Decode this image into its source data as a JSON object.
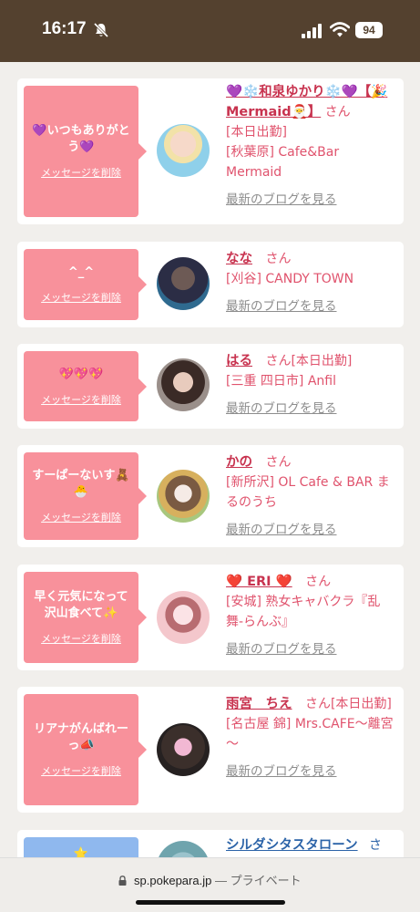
{
  "status_bar": {
    "time": "16:17",
    "battery": "94"
  },
  "labels": {
    "delete": "メッセージを削除",
    "blog": "最新のブログを見る"
  },
  "cards": [
    {
      "message": "💜いつもありがとう💜",
      "name": "💜❄️和泉ゆかり❄️💜【🎉Mermaid🎅】",
      "san": "さん",
      "tag": "[本日出勤]",
      "shop": "[秋葉原] Cafe&Bar Mermaid"
    },
    {
      "message": "^_^",
      "name": "なな",
      "san": "さん",
      "shop": "[刈谷] CANDY TOWN"
    },
    {
      "message": "💖💖💖",
      "name": "はる",
      "san": "さん[本日出勤]",
      "shop": "[三重 四日市] Anfil"
    },
    {
      "message": "すーぱーないす🧸🐣",
      "name": "かの",
      "san": "さん",
      "shop": "[新所沢] OL Cafe & BAR まるのうち"
    },
    {
      "message": "早く元気になって沢山食べて✨",
      "name": "❤️ ERI ❤️",
      "san": "さん",
      "shop": "[安城] 熟女キャバクラ『乱舞-らんぶ』"
    },
    {
      "message": "リアナがんばれーっ📣",
      "name": "雨宮　ちえ",
      "san": "さん[本日出勤]",
      "shop": "[名古屋 錦] Mrs.CAFE～離宮～"
    },
    {
      "message": "⭐",
      "name": "シルダシタスタローン",
      "san": "さ"
    }
  ],
  "browser": {
    "url": "sp.pokepara.jp",
    "separator": "—",
    "mode": "プライベート"
  },
  "colors": {
    "accent": "#f8919b",
    "name": "#c8334f",
    "status_bar": "#54412f"
  }
}
